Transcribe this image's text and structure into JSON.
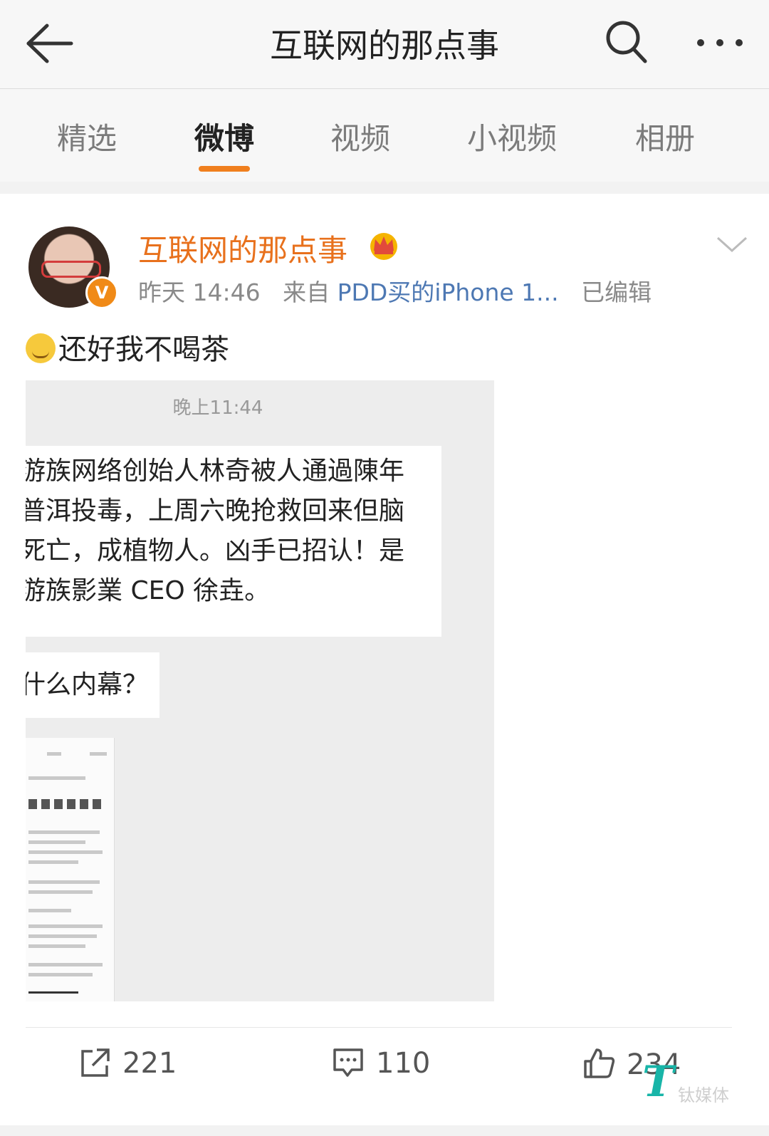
{
  "topbar": {
    "title": "互联网的那点事",
    "back_icon": "back-arrow-icon",
    "search_icon": "search-icon",
    "more_icon": "more-icon"
  },
  "tabs": [
    {
      "label": "精选"
    },
    {
      "label": "微博",
      "active": true
    },
    {
      "label": "视频"
    },
    {
      "label": "小视频"
    },
    {
      "label": "相册"
    }
  ],
  "accent_color": "#f07f1e",
  "post": {
    "username": "互联网的那点事",
    "time": "昨天 14:46",
    "from_label": "来自",
    "source": "PDD买的iPhone 1...",
    "edited": "已编辑",
    "verified_badge": "V",
    "text": "还好我不喝茶",
    "image": {
      "time": "晚上11:44",
      "bubble1": [
        "游族网络创始人林奇被人通過陳年",
        "普洱投毒，上周六晚抢救回来但脑",
        "死亡，成植物人。凶手已招认！是",
        "游族影業 CEO 徐垚。"
      ],
      "bubble2": "什么内幕？"
    }
  },
  "actions": {
    "repost": "221",
    "comment": "110",
    "like": "234"
  },
  "watermark": {
    "logo": "T",
    "text": "钛媒体"
  }
}
